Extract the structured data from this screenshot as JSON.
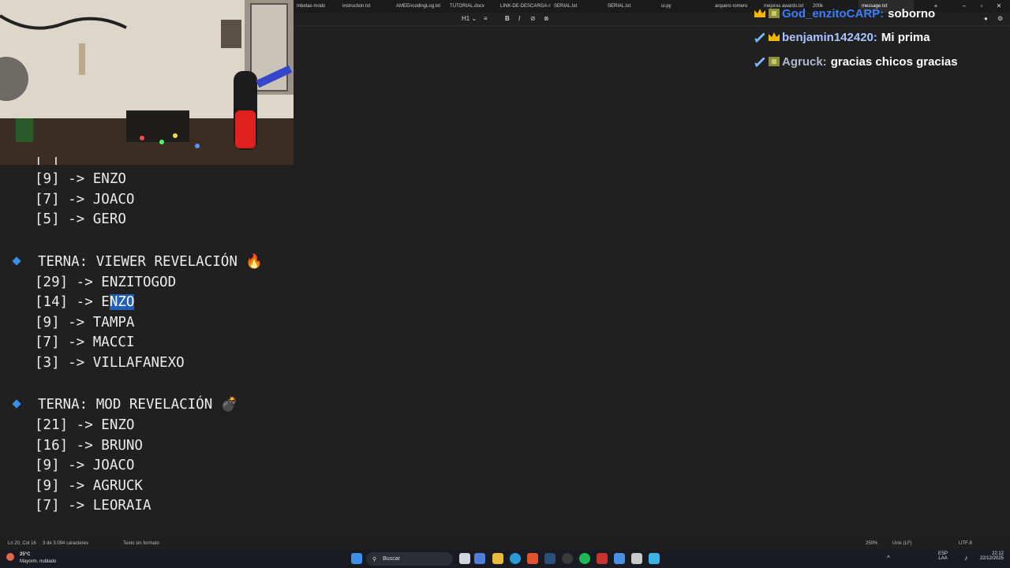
{
  "tabs": [
    {
      "label": "mbetas modo"
    },
    {
      "label": "instruction.txt"
    },
    {
      "label": "AMEEncodingLog.txt"
    },
    {
      "label": "TUTORIAL.docx"
    },
    {
      "label": "LINK-DE-DESCARGA-rx"
    },
    {
      "label": "SERIAL.txt"
    },
    {
      "label": "SERIAL.txt"
    },
    {
      "label": "ui.py"
    },
    {
      "label": "arquero romero"
    },
    {
      "label": "mejoras awards.txt"
    },
    {
      "label": "200k"
    },
    {
      "label": "message.txt"
    }
  ],
  "toolbar": {
    "heading": "H1",
    "list": "≡",
    "bold": "B",
    "italic": "I",
    "link": "⊘",
    "clear": "⊗"
  },
  "document": {
    "partial_line": "[_]",
    "group0": [
      "[9] -> ENZO",
      "[7] -> JOACO",
      "[5] -> GERO"
    ],
    "section1": {
      "title": "TERNA: VIEWER REVELACIÓN",
      "emoji": "🔥",
      "line1": "[29] -> ENZITOGOD",
      "line2_prefix": "[14] -> E",
      "line2_selected": "NZO",
      "line3": "[9] -> TAMPA",
      "line4": "[7] -> MACCI",
      "line5": "[3] -> VILLAFANEXO"
    },
    "section2": {
      "title": "TERNA: MOD REVELACIÓN",
      "emoji": "💣",
      "lines": [
        "[21] -> ENZO",
        "[16] -> BRUNO",
        "[9] -> JOACO",
        "[9] -> AGRUCK",
        "[7] -> LEORAIA"
      ]
    }
  },
  "chat": [
    {
      "user": "God_enzitoCARP:",
      "text": "soborno",
      "color": "#3d7dff"
    },
    {
      "user": "benjamin142420:",
      "text": "Mi prima",
      "color": "#a9c3ff"
    },
    {
      "user": "Agruck:",
      "text": "gracias chicos gracias",
      "color": "#b0b8c8"
    }
  ],
  "status": {
    "position": "Ln 20, Col 16",
    "chars": "3 de 3.094 caracteres",
    "format": "Texto sin formato",
    "zoom": "250%",
    "line_ending": "Unix (LF)",
    "encoding": "UTF-8"
  },
  "taskbar": {
    "weather_temp": "25°C",
    "weather_desc": "Mayorm. nublado",
    "search_placeholder": "Buscar",
    "lang": "ESP",
    "lang2": "LAA",
    "time": "22:12",
    "date": "22/12/2025"
  },
  "colors": {
    "accent": "#3a8ee6",
    "selection": "#1f5fb8"
  }
}
